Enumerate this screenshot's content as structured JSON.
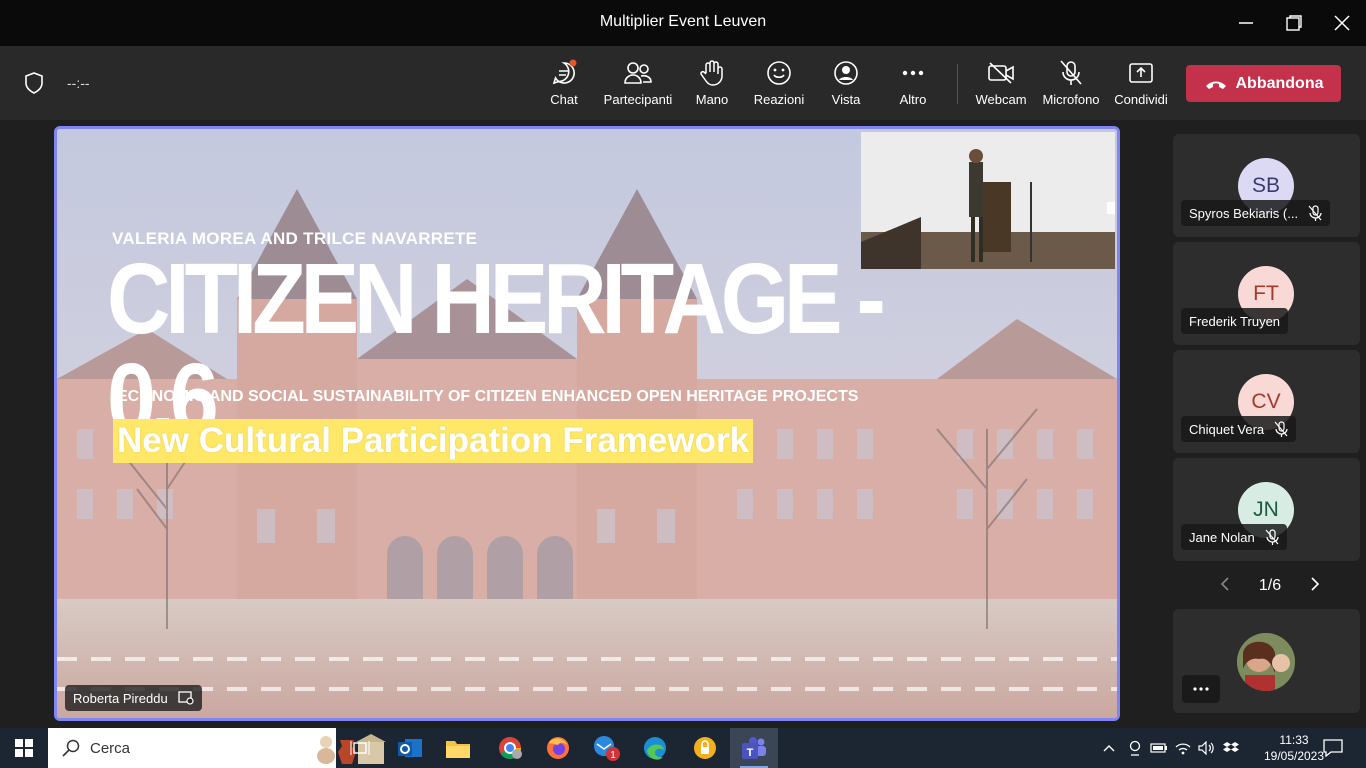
{
  "window": {
    "title": "Multiplier Event Leuven"
  },
  "toolbar": {
    "timer": "--:--",
    "buttons": [
      {
        "label": "Chat",
        "icon": "chat-icon"
      },
      {
        "label": "Partecipanti",
        "icon": "people-icon"
      },
      {
        "label": "Mano",
        "icon": "raise-hand-icon"
      },
      {
        "label": "Reazioni",
        "icon": "smiley-icon"
      },
      {
        "label": "Vista",
        "icon": "view-icon"
      },
      {
        "label": "Altro",
        "icon": "more-icon"
      },
      {
        "label": "Webcam",
        "icon": "camera-off-icon"
      },
      {
        "label": "Microfono",
        "icon": "mic-off-icon"
      },
      {
        "label": "Condividi",
        "icon": "share-icon"
      }
    ],
    "leave_label": "Abbandona"
  },
  "main": {
    "presenter": "Roberta Pireddu",
    "slide": {
      "subtitle": "VALERIA MOREA AND TRILCE NAVARRETE",
      "title": "CITIZEN HERITAGE - 0.6",
      "description": "ECONOMIC AND SOCIAL SUSTAINABILITY OF CITIZEN ENHANCED OPEN HERITAGE PROJECTS",
      "banner": "New Cultural Participation Framework"
    }
  },
  "participants": [
    {
      "initials": "SB",
      "name": "Spyros Bekiaris (...",
      "muted": true,
      "avatar_bg": "#dcd9f5",
      "avatar_fg": "#3b3a6e"
    },
    {
      "initials": "FT",
      "name": "Frederik Truyen",
      "muted": false,
      "avatar_bg": "#f8d9d6",
      "avatar_fg": "#a33a2c"
    },
    {
      "initials": "CV",
      "name": "Chiquet Vera",
      "muted": true,
      "avatar_bg": "#f8d9d6",
      "avatar_fg": "#a33a2c"
    },
    {
      "initials": "JN",
      "name": "Jane Nolan",
      "muted": true,
      "avatar_bg": "#d7ede3",
      "avatar_fg": "#1e5a40"
    }
  ],
  "pager": {
    "label": "1/6"
  },
  "taskbar": {
    "search_placeholder": "Cerca",
    "time": "11:33",
    "date": "19/05/2023",
    "mail_badge": "1"
  },
  "colors": {
    "accent": "#7f85f5",
    "leave": "#c4314b",
    "toolbar": "#292929"
  }
}
